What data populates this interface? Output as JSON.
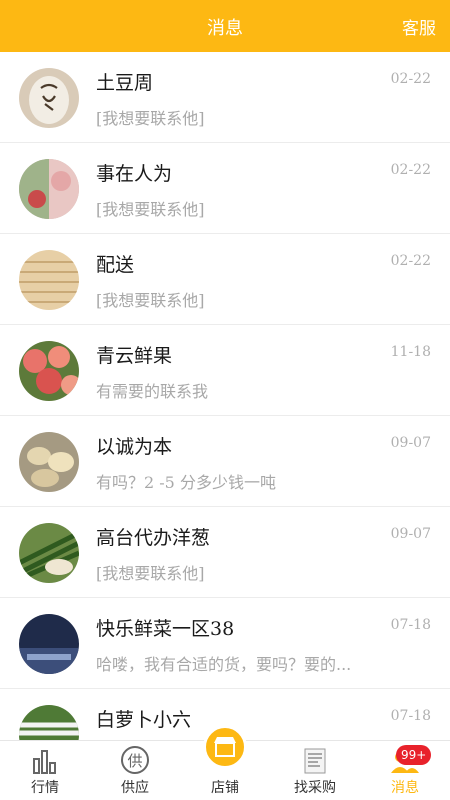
{
  "header": {
    "title": "消息",
    "service_label": "客服"
  },
  "messages": [
    {
      "name": "土豆周",
      "date": "02-22",
      "text": "[我想要联系他]",
      "avatar": "pendant-icon"
    },
    {
      "name": "事在人为",
      "date": "02-22",
      "text": "[我想要联系他]",
      "avatar": "produce-photo-icon"
    },
    {
      "name": "配送",
      "date": "02-22",
      "text": "[我想要联系他]",
      "avatar": "wood-photo-icon"
    },
    {
      "name": "青云鲜果",
      "date": "11-18",
      "text": "有需要的联系我",
      "avatar": "peaches-photo-icon"
    },
    {
      "name": "以诚为本",
      "date": "09-07",
      "text": "有吗？2 -5 分多少钱一吨",
      "avatar": "potatoes-photo-icon"
    },
    {
      "name": "高台代办洋葱",
      "date": "09-07",
      "text": "[我想要联系他]",
      "avatar": "scallions-photo-icon"
    },
    {
      "name": "快乐鲜菜一区38",
      "date": "07-18",
      "text": "哈喽，我有合适的货，要吗？要的...",
      "avatar": "night-scene-photo-icon"
    },
    {
      "name": "白萝卜小六",
      "date": "07-18",
      "text": "",
      "avatar": "radish-photo-icon"
    }
  ],
  "tabbar": {
    "tabs": [
      {
        "label": "行情",
        "icon": "bar-chart-icon"
      },
      {
        "label": "供应",
        "icon": "supply-icon"
      },
      {
        "label": "店铺",
        "icon": "store-icon"
      },
      {
        "label": "找采购",
        "icon": "purchase-icon"
      },
      {
        "label": "消息",
        "icon": "message-icon"
      }
    ],
    "active": "消息",
    "badge": "99+",
    "supply_glyph": "供"
  },
  "colors": {
    "accent": "#FDB813",
    "badge": "#E8222B",
    "muted": "#a8a8a8"
  }
}
